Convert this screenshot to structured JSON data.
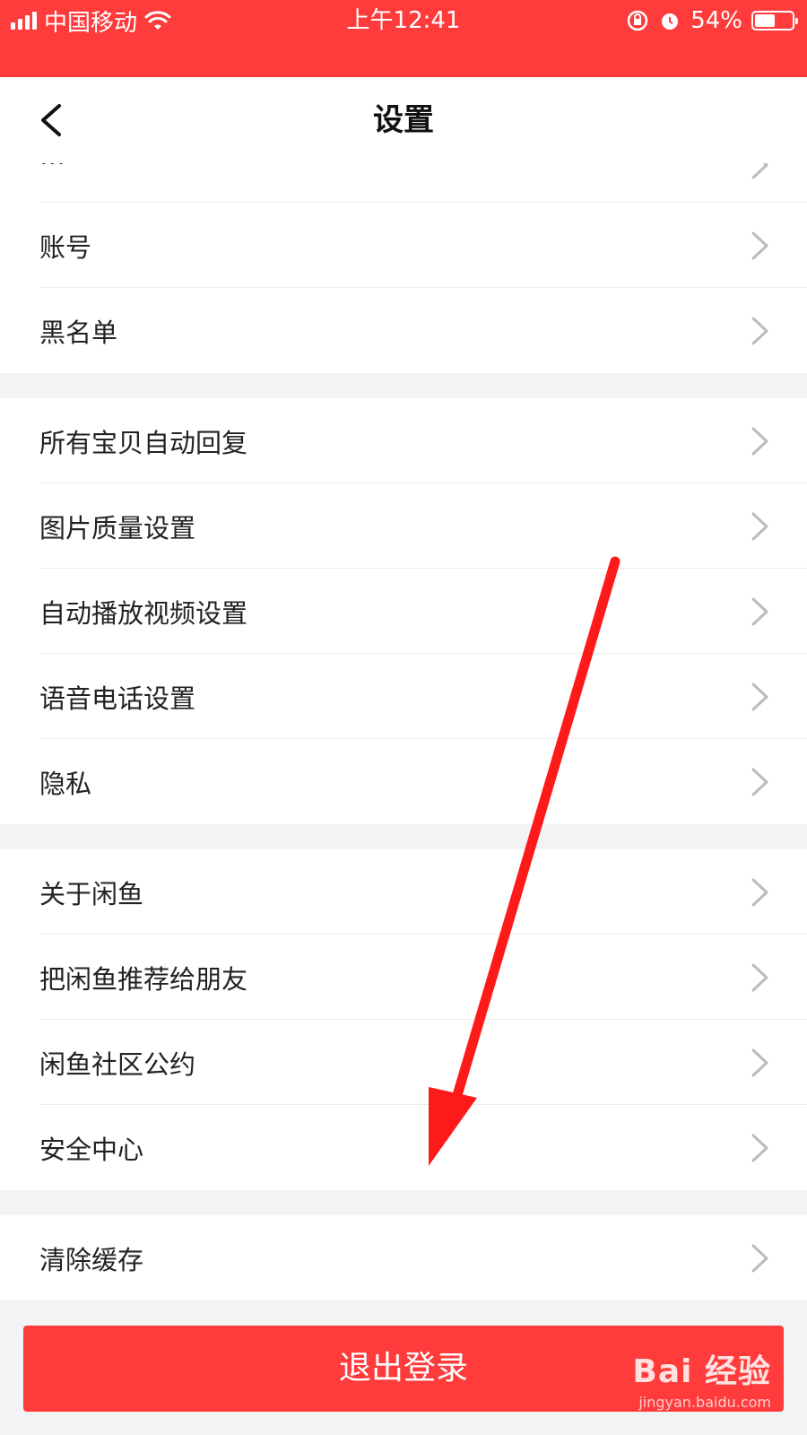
{
  "status_bar": {
    "carrier": "中国移动",
    "time": "上午12:41",
    "battery": "54%",
    "battery_level": 0.54
  },
  "nav": {
    "title": "设置"
  },
  "groups": [
    [
      {
        "label": "…"
      },
      {
        "label": "账号"
      },
      {
        "label": "黑名单"
      }
    ],
    [
      {
        "label": "所有宝贝自动回复"
      },
      {
        "label": "图片质量设置"
      },
      {
        "label": "自动播放视频设置"
      },
      {
        "label": "语音电话设置"
      },
      {
        "label": "隐私"
      }
    ],
    [
      {
        "label": "关于闲鱼"
      },
      {
        "label": "把闲鱼推荐给朋友"
      },
      {
        "label": "闲鱼社区公约"
      },
      {
        "label": "安全中心"
      }
    ],
    [
      {
        "label": "清除缓存"
      }
    ]
  ],
  "logout_label": "退出登录",
  "watermark": {
    "brand": "Bai 经验",
    "url": "jingyan.baidu.com"
  },
  "colors": {
    "accent": "#ff3b3b",
    "arrow": "#ff1a1a"
  },
  "icons": {
    "back": "chevron-left-icon",
    "row": "chevron-right-icon"
  }
}
